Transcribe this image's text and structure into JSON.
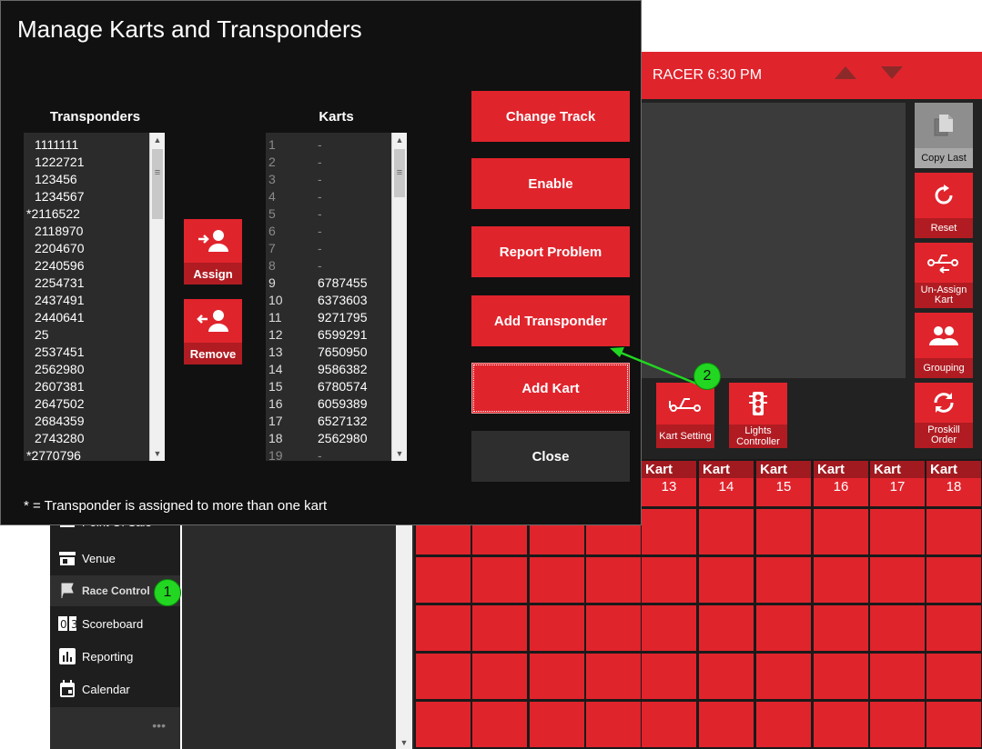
{
  "dialog": {
    "title": "Manage Karts and Transponders",
    "transponders_header": "Transponders",
    "karts_header": "Karts",
    "transponders": [
      "1111111",
      "1222721",
      "123456",
      "1234567",
      "*2116522",
      "2118970",
      "2204670",
      "2240596",
      "2254731",
      "2437491",
      "2440641",
      "25",
      "2537451",
      "2562980",
      "2607381",
      "2647502",
      "2684359",
      "2743280",
      "*2770796"
    ],
    "karts": [
      {
        "num": "1",
        "transponder": "-"
      },
      {
        "num": "2",
        "transponder": "-"
      },
      {
        "num": "3",
        "transponder": "-"
      },
      {
        "num": "4",
        "transponder": "-"
      },
      {
        "num": "5",
        "transponder": "-"
      },
      {
        "num": "6",
        "transponder": "-"
      },
      {
        "num": "7",
        "transponder": "-"
      },
      {
        "num": "8",
        "transponder": "-"
      },
      {
        "num": "9",
        "transponder": "6787455"
      },
      {
        "num": "10",
        "transponder": "6373603"
      },
      {
        "num": "11",
        "transponder": "9271795"
      },
      {
        "num": "12",
        "transponder": "6599291"
      },
      {
        "num": "13",
        "transponder": "7650950"
      },
      {
        "num": "14",
        "transponder": "9586382"
      },
      {
        "num": "15",
        "transponder": "6780574"
      },
      {
        "num": "16",
        "transponder": "6059389"
      },
      {
        "num": "17",
        "transponder": "6527132"
      },
      {
        "num": "18",
        "transponder": "2562980"
      },
      {
        "num": "19",
        "transponder": "-"
      }
    ],
    "assign_label": "Assign",
    "remove_label": "Remove",
    "buttons": {
      "change_track": "Change Track",
      "enable": "Enable",
      "report_problem": "Report Problem",
      "add_transponder": "Add Transponder",
      "add_kart": "Add Kart",
      "close": "Close"
    },
    "footnote": "* = Transponder is assigned to more than one kart"
  },
  "race": {
    "header_title": "RACER 6:30 PM",
    "side_buttons": {
      "copy_last": "Copy Last",
      "reset": "Reset",
      "unassign": "Un-Assign Kart",
      "grouping": "Grouping",
      "proskill": "Proskill Order"
    },
    "kart_setting": "Kart Setting",
    "lights_controller": "Lights Controller",
    "kart_word": "Kart",
    "kart_numbers": [
      "13",
      "14",
      "15",
      "16",
      "17",
      "18"
    ]
  },
  "nav": {
    "items": [
      "Point Of Sale",
      "Venue",
      "Race Control",
      "Scoreboard",
      "Reporting",
      "Calendar"
    ],
    "more": "•••"
  },
  "badges": [
    "1",
    "2"
  ],
  "colors": {
    "accent": "#e0242c",
    "accent_dark": "#b01c22",
    "dialog_bg": "#111111",
    "highlight": "#22d622"
  }
}
